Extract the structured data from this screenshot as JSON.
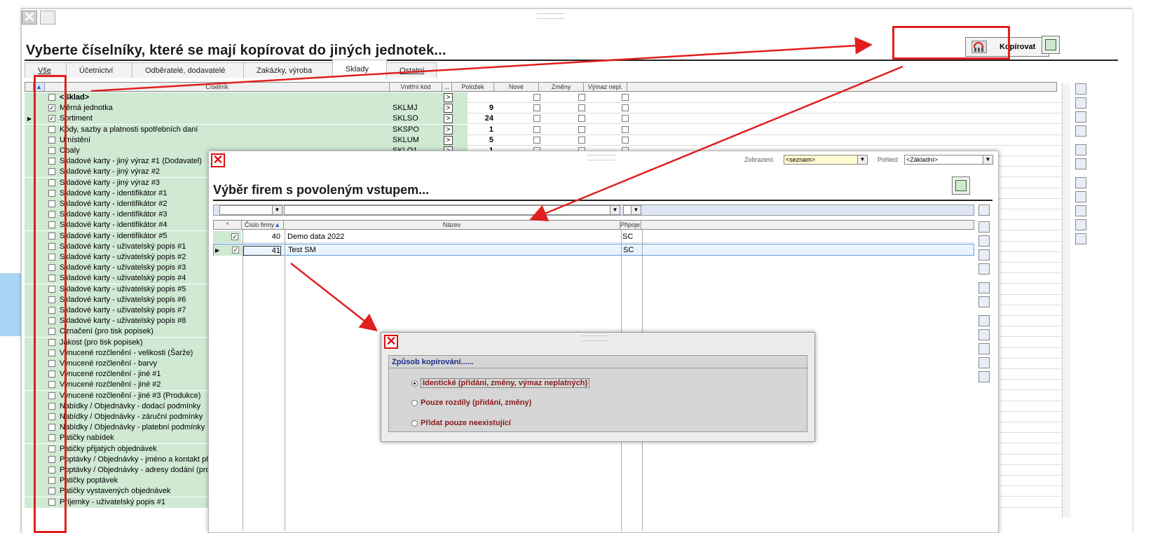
{
  "window": {
    "title": "Vyberte číselníky, které se mají kopírovat do jiných jednotek...",
    "copy_button": "Kopírovat"
  },
  "tabs": [
    {
      "label": "Vše",
      "active": false
    },
    {
      "label": "Účetnictví",
      "active": false
    },
    {
      "label": "Odběratelé, dodavatelé",
      "active": false
    },
    {
      "label": "Zakázky, výroba",
      "active": false
    },
    {
      "label": "Sklady",
      "active": true
    },
    {
      "label": "Ostatní",
      "active": false
    }
  ],
  "grid": {
    "columns": [
      "Číselník",
      "Vnitřní kód",
      "...",
      "Položek",
      "Nové",
      "Změny",
      "Výmaz nepl."
    ],
    "rows": [
      {
        "name": "<Sklad>",
        "code": "",
        "count": "",
        "checked": false,
        "bold": true
      },
      {
        "name": "Měrná jednotka",
        "code": "SKLMJ",
        "count": "9",
        "checked": true
      },
      {
        "name": "Sortiment",
        "code": "SKLSO",
        "count": "24",
        "checked": true,
        "current": true
      },
      {
        "name": "Kódy, sazby a platnosti spotřebních daní",
        "code": "SKSPO",
        "count": "1",
        "checked": false
      },
      {
        "name": "Umístění",
        "code": "SKLUM",
        "count": "5",
        "checked": false
      },
      {
        "name": "Obaly",
        "code": "SKLO1",
        "count": "1",
        "checked": false
      },
      {
        "name": "Skladové karty - jiný výraz #1 (Dodavatel)",
        "checked": false
      },
      {
        "name": "Skladové karty - jiný výraz #2",
        "checked": false
      },
      {
        "name": "Skladové karty - jiný výraz #3",
        "checked": false
      },
      {
        "name": "Skladové karty - identifikátor #1",
        "checked": false
      },
      {
        "name": "Skladové karty - identifikátor #2",
        "checked": false
      },
      {
        "name": "Skladové karty - identifikátor #3",
        "checked": false
      },
      {
        "name": "Skladové karty - identifikátor #4",
        "checked": false
      },
      {
        "name": "Skladové karty - identifikátor #5",
        "checked": false
      },
      {
        "name": "Skladové karty - uživatelský popis #1",
        "checked": false
      },
      {
        "name": "Skladové karty - uživatelský popis #2",
        "checked": false
      },
      {
        "name": "Skladové karty - uživatelský popis #3",
        "checked": false
      },
      {
        "name": "Skladové karty - uživatelský popis #4",
        "checked": false
      },
      {
        "name": "Skladové karty - uživatelský popis #5",
        "checked": false
      },
      {
        "name": "Skladové karty - uživatelský popis #6",
        "checked": false
      },
      {
        "name": "Skladové karty - uživatelský popis #7",
        "checked": false
      },
      {
        "name": "Skladové karty - uživatelský popis #8",
        "checked": false
      },
      {
        "name": "Označení (pro tisk popisek)",
        "checked": false
      },
      {
        "name": "Jakost (pro tisk popisek)",
        "checked": false
      },
      {
        "name": "Vynucené rozčlenění - velikosti (Šarže)",
        "checked": false
      },
      {
        "name": "Vynucené rozčlenění - barvy",
        "checked": false
      },
      {
        "name": "Vynucené rozčlenění - jiné #1",
        "checked": false
      },
      {
        "name": "Vynucené rozčlenění - jiné #2",
        "checked": false
      },
      {
        "name": "Vynucené rozčlenění - jiné #3 (Produkce)",
        "checked": false
      },
      {
        "name": "Nabídky / Objednávky - dodací podmínky",
        "checked": false
      },
      {
        "name": "Nabídky / Objednávky - záruční podmínky",
        "checked": false
      },
      {
        "name": "Nabídky / Objednávky - platební podmínky",
        "checked": false
      },
      {
        "name": "Patičky nabídek",
        "checked": false
      },
      {
        "name": "Patičky přijatých objednávek",
        "checked": false
      },
      {
        "name": "Poptávky / Objednávky - jméno a kontakt při",
        "checked": false
      },
      {
        "name": "Poptávky / Objednávky - adresy dodání (pro",
        "checked": false
      },
      {
        "name": "Patičky poptávek",
        "checked": false
      },
      {
        "name": "Patičky vystavených objednávek",
        "checked": false
      },
      {
        "name": "Příjemky - uživatelský popis #1",
        "checked": false
      }
    ]
  },
  "firm_dialog": {
    "title": "Výběr firem s povoleným vstupem...",
    "view_label": "Zobrazení:",
    "view_value": "<seznam>",
    "pohled_label": "Pohled:",
    "pohled_value": "<Základní>",
    "columns": [
      "*",
      "Číslo firmy",
      "Název",
      "Připoje"
    ],
    "rows": [
      {
        "number": "40",
        "name": "Demo data 2022",
        "conn": "SC",
        "checked": true
      },
      {
        "number": "41",
        "name": "Test SM",
        "conn": "SC",
        "checked": true,
        "current": true
      }
    ]
  },
  "copy_mode_dialog": {
    "group_title": "Způsob kopírování......",
    "options": [
      {
        "label": "Identické (přidání, změny, výmaz neplatných)",
        "selected": true
      },
      {
        "label": "Pouze rozdíly (přidání, změny)",
        "selected": false
      },
      {
        "label": "Přidat pouze neexistující",
        "selected": false
      }
    ]
  },
  "colors": {
    "annotation_red": "#e0201e",
    "grid_green": "#cfe9d3",
    "option_text": "#8b1a1a",
    "group_title": "#1d2f8a"
  }
}
